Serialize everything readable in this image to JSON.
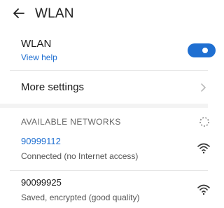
{
  "header": {
    "title": "WLAN",
    "back_icon": "arrow-left-icon"
  },
  "wlan_row": {
    "label": "WLAN",
    "help_link": "View help",
    "toggle_on": true
  },
  "more_settings": {
    "label": "More settings"
  },
  "networks": {
    "section_title": "AVAILABLE NETWORKS",
    "items": [
      {
        "ssid": "90999112",
        "status": "Connected (no Internet access)",
        "ssid_color": "#1f6fd1"
      },
      {
        "ssid": "90099925",
        "status": "Saved, encrypted (good quality)",
        "ssid_color": "#1a1a1a"
      }
    ]
  },
  "colors": {
    "accent": "#1f6fd1"
  }
}
